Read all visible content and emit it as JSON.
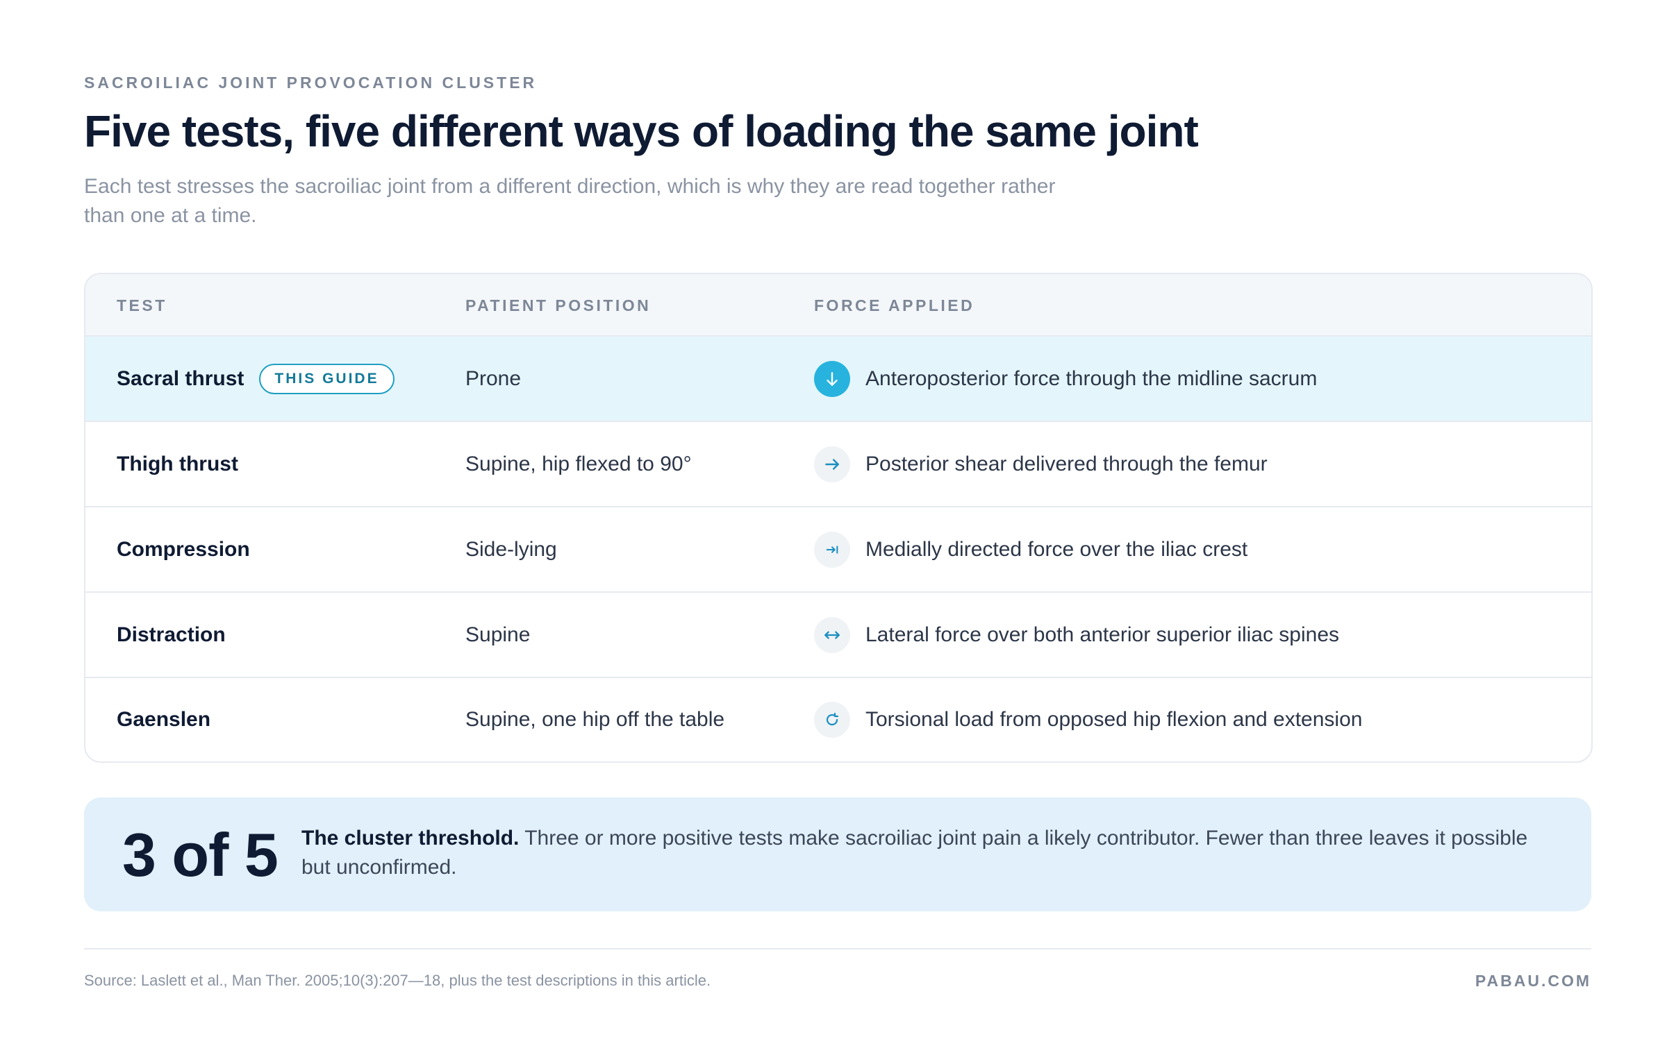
{
  "header": {
    "eyebrow": "SACROILIAC JOINT PROVOCATION CLUSTER",
    "title": "Five tests, five different ways of loading the same joint",
    "subtitle": "Each test stresses the sacroiliac joint from a different direction, which is why they are read together rather than one at a time."
  },
  "table": {
    "columns": [
      "TEST",
      "PATIENT POSITION",
      "FORCE APPLIED"
    ],
    "rows": [
      {
        "test": "Sacral thrust",
        "badge": "THIS GUIDE",
        "position": "Prone",
        "force": "Anteroposterior force through the midline sacrum",
        "icon": "arrow-down-icon",
        "highlighted": true
      },
      {
        "test": "Thigh thrust",
        "badge": "",
        "position": "Supine, hip flexed to 90°",
        "force": "Posterior shear delivered through the femur",
        "icon": "arrow-right-icon",
        "highlighted": false
      },
      {
        "test": "Compression",
        "badge": "",
        "position": "Side-lying",
        "force": "Medially directed force over the iliac crest",
        "icon": "arrow-right-to-bar-icon",
        "highlighted": false
      },
      {
        "test": "Distraction",
        "badge": "",
        "position": "Supine",
        "force": "Lateral force over both anterior superior iliac spines",
        "icon": "arrow-left-right-icon",
        "highlighted": false
      },
      {
        "test": "Gaenslen",
        "badge": "",
        "position": "Supine, one hip off the table",
        "force": "Torsional load from opposed hip flexion and extension",
        "icon": "rotate-clockwise-icon",
        "highlighted": false
      }
    ]
  },
  "callout": {
    "number": "3 of 5",
    "lead": "The cluster threshold.",
    "text": "Three or more positive tests make sacroiliac joint pain a likely contributor. Fewer than three leaves it possible but unconfirmed."
  },
  "footer": {
    "source": "Source: Laslett et al., Man Ther. 2005;10(3):207—18, plus the test descriptions in this article.",
    "brand": "PABAU.COM"
  },
  "colors": {
    "accent": "#27b3de",
    "highlight_row": "#e4f6fb",
    "callout_bg": "#e1f0fa",
    "heading": "#0f1b33",
    "muted": "#8a93a2"
  }
}
